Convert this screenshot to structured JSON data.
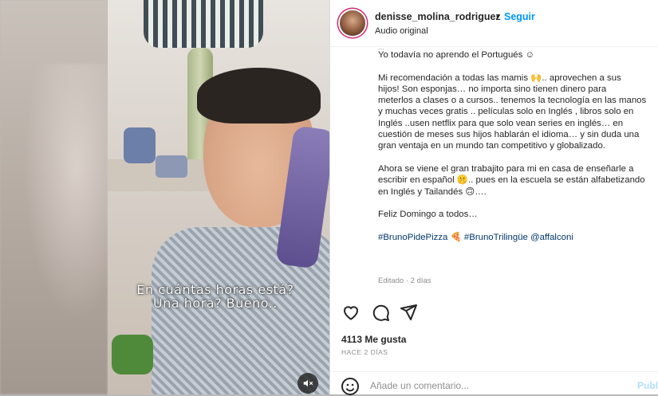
{
  "video": {
    "caption_line1": "En cuántas horas está?",
    "caption_line2": "Una hora? Bueno.."
  },
  "post": {
    "username": "denisse_molina_rodriguez",
    "separator": "•",
    "follow_label": "Seguir",
    "audio_label": "Audio original",
    "caption_lines": [
      "Yo todavía no aprendo el Portugués ☺",
      "",
      "Mi recomendación a todas las mamis 🙌.. aprovechen a sus",
      "hijos! Son esponjas… no importa sino tienen dinero para",
      "meterlos a clases o a cursos.. tenemos la tecnología en las manos",
      "y muchas veces gratis .. películas solo en Inglés , libros solo en",
      "Inglés ..usen netflix para que solo vean series en inglés… en",
      "cuestión de meses sus hijos hablarán el idioma… y sin duda una",
      "gran ventaja en un mundo tan competitivo y globalizado.",
      "",
      "Ahora se viene el gran trabajito para mi en casa de enseñarle a",
      "escribir en español 🤫.. pues en la escuela se están alfabetizando",
      "en Inglés y Tailandés 🙃….",
      "",
      "Feliz Domingo a todos…"
    ],
    "hashtags": [
      "#BrunoPidePizza 🍕",
      "#BrunoTrilingüe",
      "@affalconi"
    ],
    "edited_label": "Editado · 2 días",
    "likes": "4113 Me gusta",
    "time_ago": "HACE 2 DÍAS",
    "comment_placeholder": "Añade un comentario...",
    "publish_label": "Publi"
  },
  "icons": {
    "like": "heart-icon",
    "comment": "comment-icon",
    "share": "send-icon",
    "emoji": "smiley-icon",
    "mute": "muted-speaker-icon"
  },
  "colors": {
    "follow": "#0095f6",
    "link": "#00376b",
    "muted_text": "#8e8e8e",
    "publish_disabled": "#b2dffc"
  }
}
